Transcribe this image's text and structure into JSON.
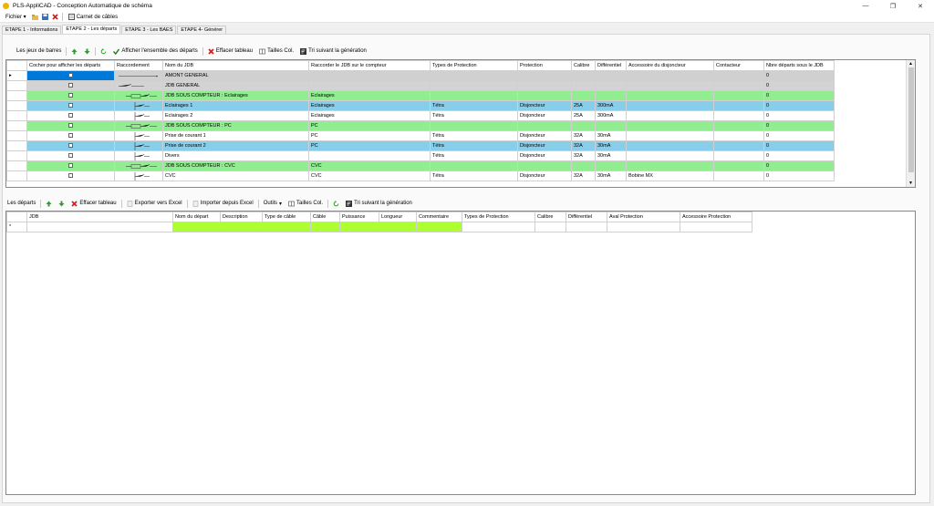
{
  "window": {
    "title": "PLS-AppliCAD - Conception Automatique de schéma",
    "minimize": "—",
    "maximize": "❐",
    "close": "✕"
  },
  "menu": {
    "fichier": "Fichier",
    "carnet": "Carnet de câbles"
  },
  "steps": [
    "ETAPE 1 - Informations",
    "ETAPE 2 - Les départs",
    "ETAPE 3 - Les BAES",
    "ETAPE 4- Générer"
  ],
  "toolbar1": {
    "jeux": "Les jeux de barres",
    "afficher": "Afficher l'ensemble des départs",
    "effacer": "Effacer tableau",
    "tailles": "Tailles Col.",
    "tri": "Tri suivant la génération"
  },
  "grid1": {
    "headers": [
      "Cocher pour afficher les départs",
      "Raccordement",
      "Nom du JDB",
      "Raccorder le JDB sur le compteur",
      "Types de Protection",
      "Protection",
      "Calibre",
      "Différentiel",
      "Accessoire du disjoncteur",
      "Contacteur",
      "Nbre départs sous le JDB"
    ],
    "rows": [
      {
        "style": "sel",
        "nom": "AMONT GENERAL",
        "raccorder": "",
        "types": "",
        "protection": "",
        "calibre": "",
        "diff": "",
        "acc": "",
        "cont": "",
        "nbre": "0"
      },
      {
        "style": "gray",
        "nom": "JDB GENERAL",
        "raccorder": "",
        "types": "",
        "protection": "",
        "calibre": "",
        "diff": "",
        "acc": "",
        "cont": "",
        "nbre": "0"
      },
      {
        "style": "green",
        "nom": "JDB SOUS COMPTEUR : Eclairages",
        "raccorder": "Eclairages",
        "types": "",
        "protection": "",
        "calibre": "",
        "diff": "",
        "acc": "",
        "cont": "",
        "nbre": "0"
      },
      {
        "style": "blue",
        "nom": "Eclairages 1",
        "raccorder": "Eclairages",
        "types": "Tétra",
        "protection": "Disjoncteur",
        "calibre": "25A",
        "diff": "300mA",
        "acc": "",
        "cont": "",
        "nbre": "0"
      },
      {
        "style": "white",
        "nom": "Eclairages 2",
        "raccorder": "Eclairages",
        "types": "Tétra",
        "protection": "Disjoncteur",
        "calibre": "25A",
        "diff": "300mA",
        "acc": "",
        "cont": "",
        "nbre": "0"
      },
      {
        "style": "green",
        "nom": "JDB SOUS COMPTEUR : PC",
        "raccorder": "PC",
        "types": "",
        "protection": "",
        "calibre": "",
        "diff": "",
        "acc": "",
        "cont": "",
        "nbre": "0"
      },
      {
        "style": "white",
        "nom": "Prise de courant 1",
        "raccorder": "PC",
        "types": "Tétra",
        "protection": "Disjoncteur",
        "calibre": "32A",
        "diff": "30mA",
        "acc": "",
        "cont": "",
        "nbre": "0"
      },
      {
        "style": "blue",
        "nom": "Prise de courant 2",
        "raccorder": "PC",
        "types": "Tétra",
        "protection": "Disjoncteur",
        "calibre": "32A",
        "diff": "30mA",
        "acc": "",
        "cont": "",
        "nbre": "0"
      },
      {
        "style": "white",
        "nom": "Divers",
        "raccorder": "",
        "types": "Tétra",
        "protection": "Disjoncteur",
        "calibre": "32A",
        "diff": "30mA",
        "acc": "",
        "cont": "",
        "nbre": "0"
      },
      {
        "style": "green",
        "nom": "JDB SOUS COMPTEUR : CVC",
        "raccorder": "CVC",
        "types": "",
        "protection": "",
        "calibre": "",
        "diff": "",
        "acc": "",
        "cont": "",
        "nbre": "0"
      },
      {
        "style": "white",
        "nom": "CVC",
        "raccorder": "CVC",
        "types": "Tétra",
        "protection": "Disjoncteur",
        "calibre": "32A",
        "diff": "30mA",
        "acc": "Bobine MX",
        "cont": "",
        "nbre": "0"
      }
    ]
  },
  "toolbar2": {
    "departs": "Les départs",
    "effacer": "Effacer tableau",
    "exporter": "Exporter vers Excel",
    "importer": "Importer depuis Excel",
    "outils": "Outils",
    "tailles": "Tailles Col.",
    "tri": "Tri suivant la génération"
  },
  "grid2": {
    "headers": [
      "JDB",
      "Nom du départ",
      "Description",
      "Type de câble",
      "Câble",
      "Puissance",
      "Longueur",
      "Commentaire",
      "Types de Protection",
      "Calibre",
      "Différentiel",
      "Aval Protection",
      "Accessoire Protection"
    ],
    "new_row_marker": "*"
  },
  "colors": {
    "green": "#90ee90",
    "blue": "#87ceeb",
    "gray": "#d3d3d3",
    "selected": "#0078d7",
    "lime": "#adff2f"
  }
}
